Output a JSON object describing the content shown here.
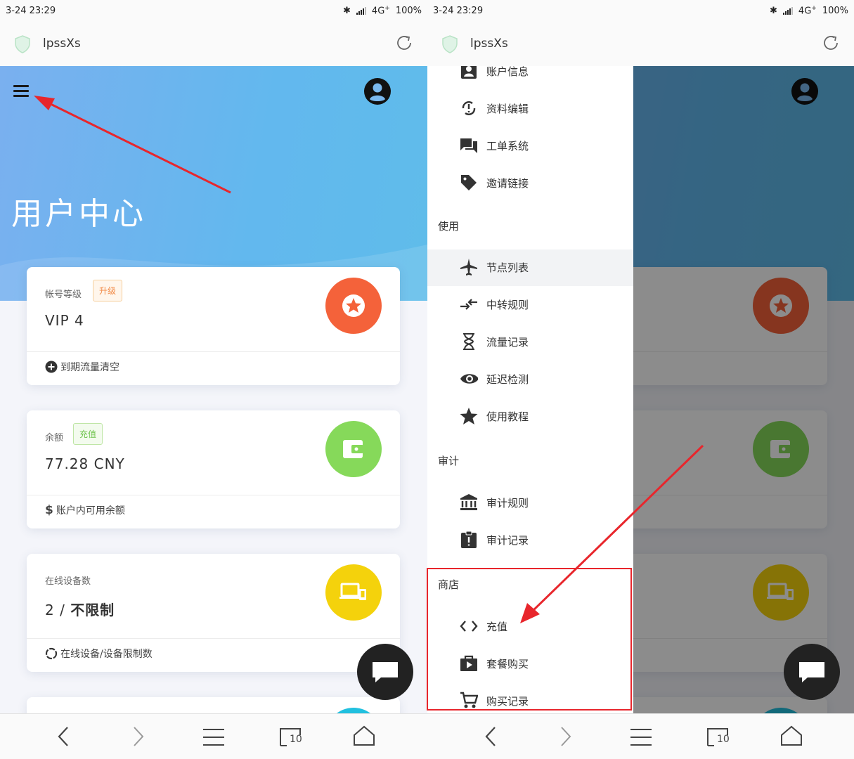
{
  "left": {
    "status": {
      "time": "3-24 23:29",
      "network": "4G",
      "network_plus": "+",
      "battery": "100%"
    },
    "address": {
      "site": "lpssXs"
    },
    "hero": {
      "title": "用户中心"
    },
    "cards": [
      {
        "label": "帐号等级",
        "tag": "升级",
        "value": "VIP  4",
        "footer": "到期流量清空",
        "color": "#f4623a"
      },
      {
        "label": "余额",
        "tag": "充值",
        "value": "77.28  CNY",
        "footer": "账户内可用余额",
        "color": "#86d95a"
      },
      {
        "label": "在线设备数",
        "value": "2  /  ",
        "value_strong": "不限制",
        "footer": "在线设备/设备限制数",
        "color": "#f4d20c"
      }
    ]
  },
  "right": {
    "status": {
      "time": "3-24 23:29",
      "network": "4G",
      "network_plus": "+",
      "battery": "100%"
    },
    "address": {
      "site": "lpssXs"
    },
    "drawer": {
      "items_top": [
        "账户信息",
        "资料编辑",
        "工单系统",
        "邀请链接"
      ],
      "section_use": "使用",
      "items_use": [
        "节点列表",
        "中转规则",
        "流量记录",
        "延迟检测",
        "使用教程"
      ],
      "section_audit": "审计",
      "items_audit": [
        "审计规则",
        "审计记录"
      ],
      "section_shop": "商店",
      "items_shop": [
        "充值",
        "套餐购买",
        "购买记录"
      ]
    }
  },
  "bottom_nav": {
    "tab_count": "10"
  },
  "colors": {
    "annotation": "#e8262c",
    "hero_gradient_start": "#7ab0ef",
    "hero_gradient_end": "#5fbcea"
  },
  "icons": [
    "shield-icon",
    "reload-icon",
    "hamburger-icon",
    "account-circle-icon",
    "star-badge-icon",
    "wallet-icon",
    "devices-icon",
    "chat-icon",
    "back-icon",
    "forward-icon",
    "menu-icon",
    "tabs-icon",
    "home-icon"
  ]
}
